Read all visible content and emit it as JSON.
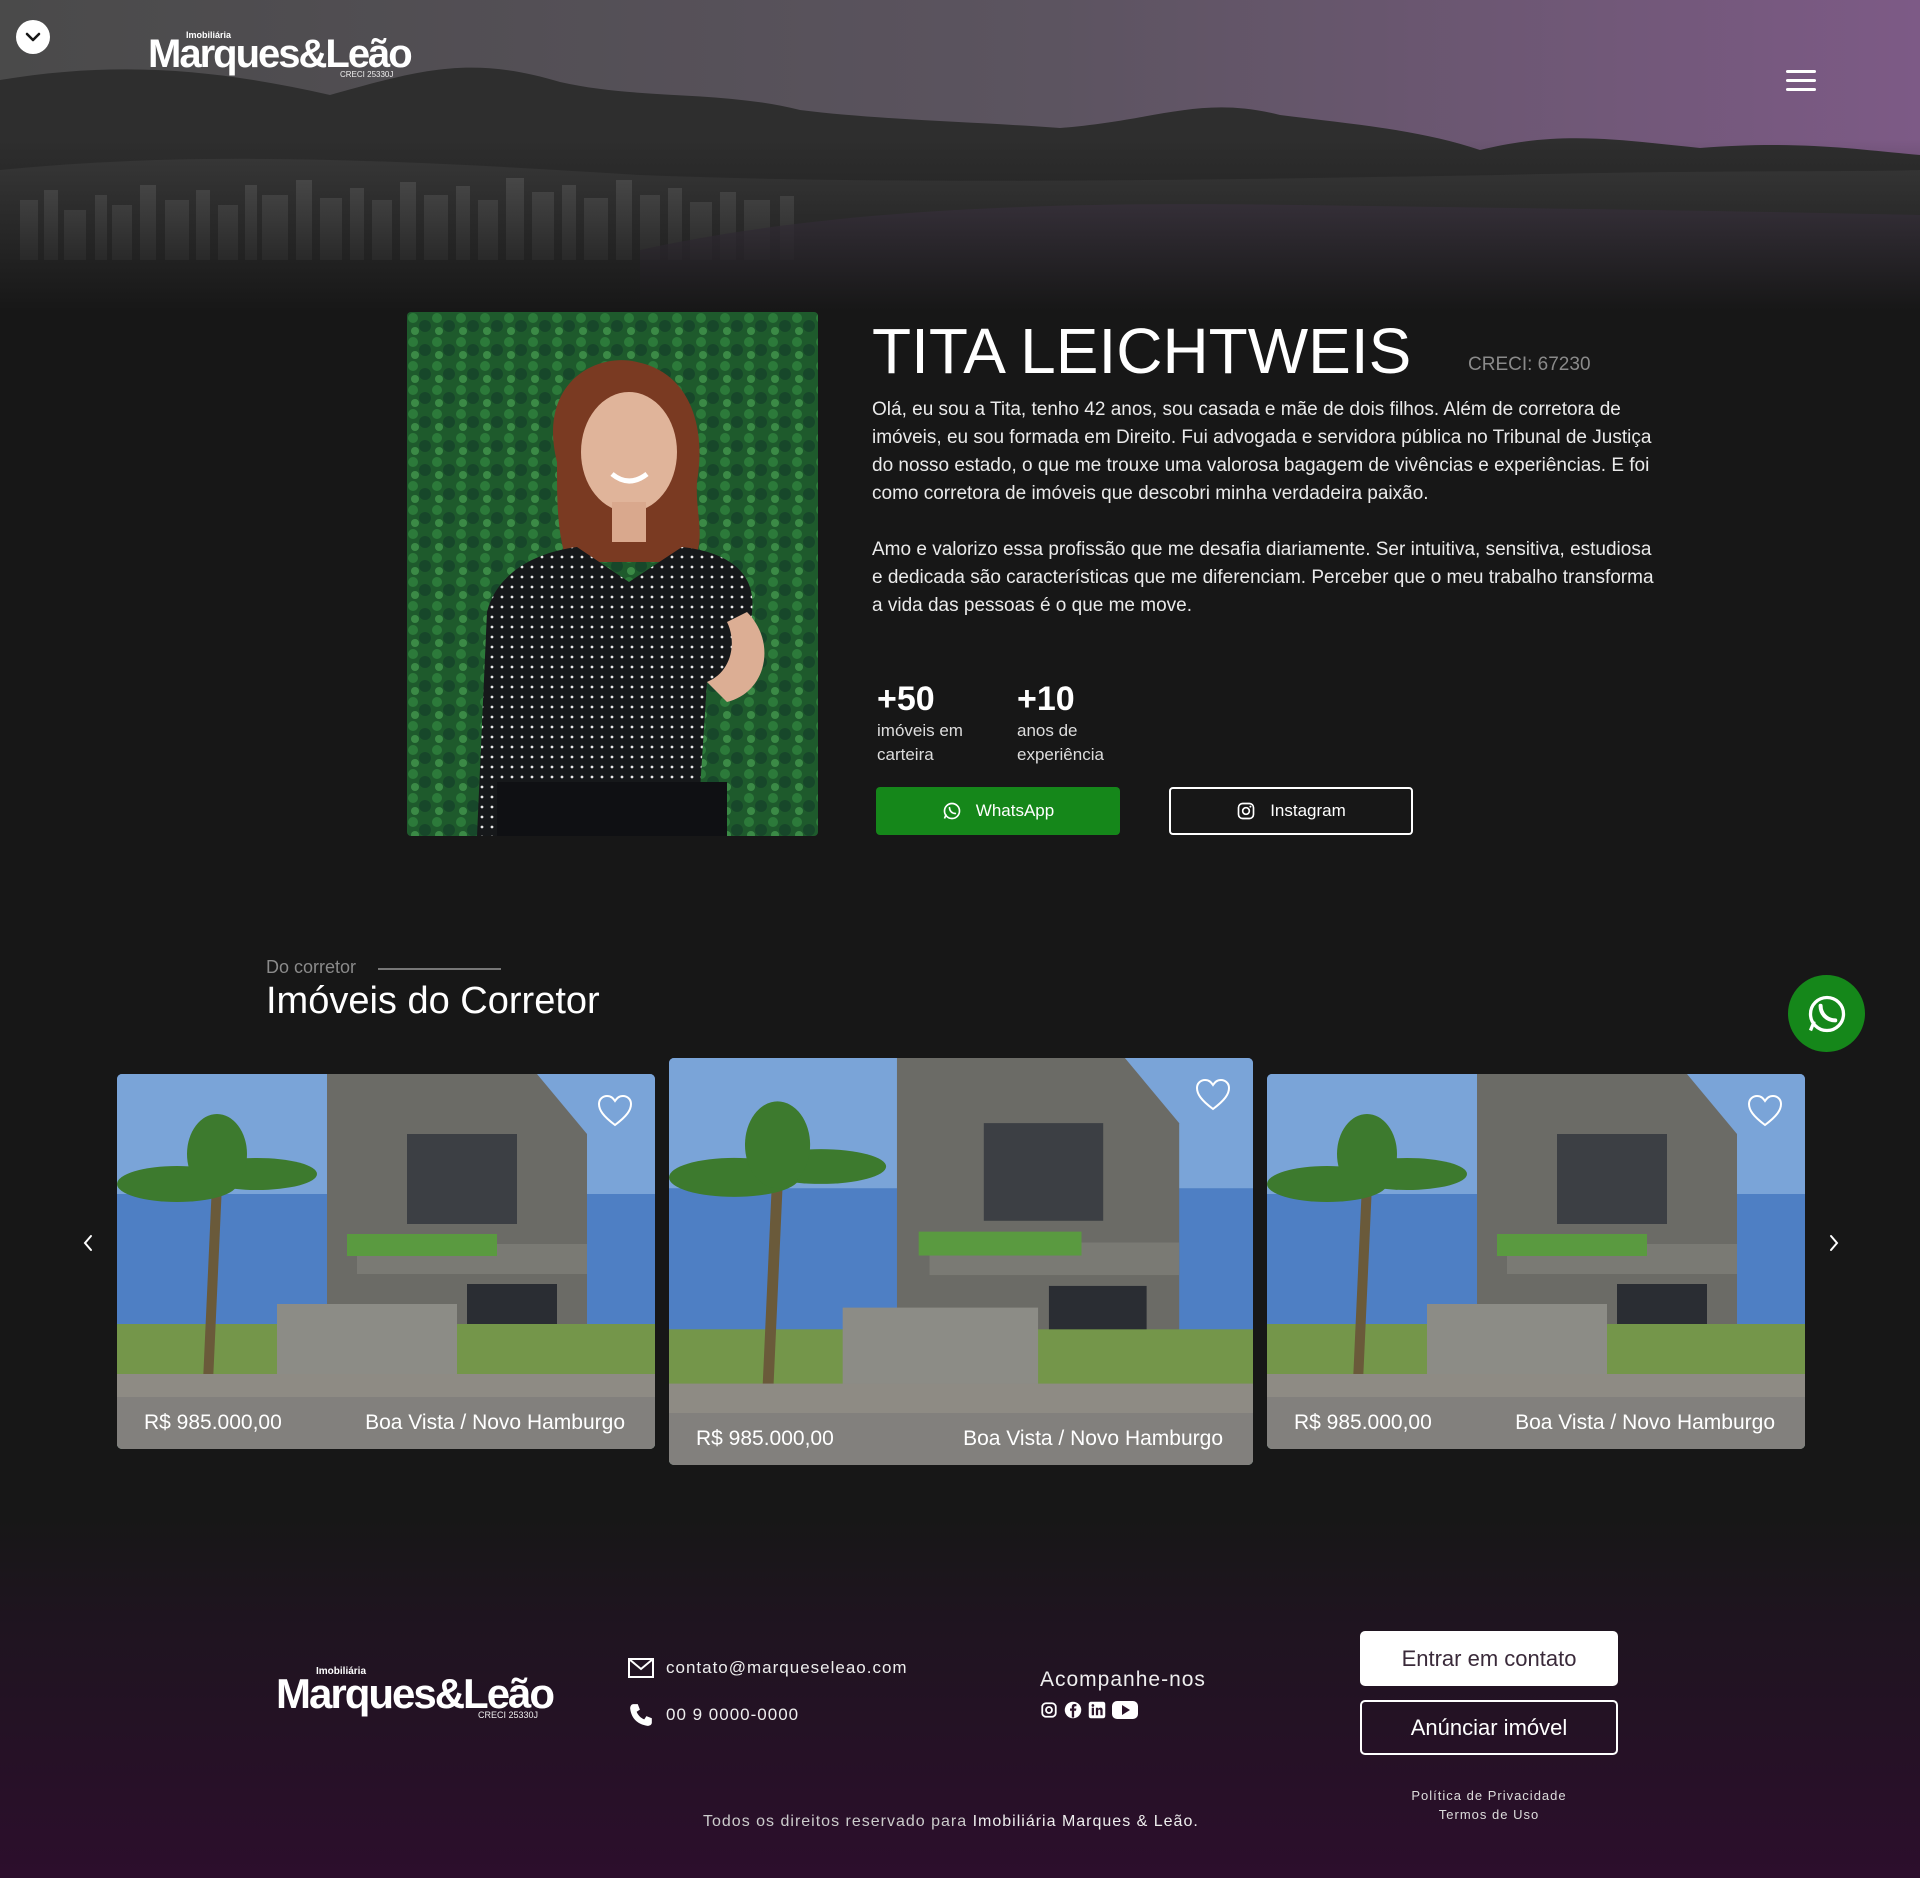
{
  "brand": {
    "small": "Imobiliária",
    "name": "Marques&Leão",
    "creci": "CRECI 25330J"
  },
  "agent": {
    "name": "TITA LEICHTWEIS",
    "creci": "CRECI: 67230",
    "bio": [
      "Olá, eu sou a Tita, tenho 42 anos, sou casada e mãe de dois filhos. Além de corretora de imóveis, eu sou formada em Direito. Fui advogada e servidora pública no Tribunal de Justiça do nosso estado, o que me trouxe uma valorosa bagagem de vivências e experiências.  E foi como corretora de imóveis que descobri minha verdadeira paixão.",
      "Amo e valorizo essa profissão que me desafia diariamente. Ser intuitiva, sensitiva, estudiosa e dedicada são características que me diferenciam. Perceber que o meu trabalho transforma a vida das pessoas é o que me move."
    ],
    "stats": [
      {
        "value": "+50",
        "label": "imóveis em carteira"
      },
      {
        "value": "+10",
        "label": "anos de experiência"
      }
    ],
    "whatsapp_label": "WhatsApp",
    "instagram_label": "Instagram"
  },
  "listings": {
    "eyebrow": "Do corretor",
    "title": "Imóveis do Corretor",
    "items": [
      {
        "price": "R$ 985.000,00",
        "location": "Boa Vista / Novo Hamburgo"
      },
      {
        "price": "R$ 985.000,00",
        "location": "Boa Vista / Novo Hamburgo"
      },
      {
        "price": "R$ 985.000,00",
        "location": "Boa Vista / Novo Hamburgo"
      }
    ]
  },
  "footer": {
    "email": "contato@marqueseleao.com",
    "phone": "00 9 0000-0000",
    "follow": "Acompanhe-nos",
    "contact_button": "Entrar em contato",
    "announce_button": "Anúnciar imóvel",
    "privacy": "Política de Privacidade",
    "terms": "Termos de Uso",
    "rights_prefix": "Todos os direitos reservado para",
    "rights_company": "Imobiliária Marques & Leão."
  },
  "colors": {
    "background": "#171717",
    "whatsapp_green": "#15871a",
    "footer_purple": "#2c0e2c",
    "hero_purple": "#7d5a86"
  },
  "icons": [
    "chevron-down-icon",
    "menu-icon",
    "whatsapp-icon",
    "instagram-icon",
    "heart-icon",
    "chevron-left-icon",
    "chevron-right-icon",
    "mail-icon",
    "phone-icon",
    "facebook-icon",
    "linkedin-icon",
    "youtube-icon"
  ]
}
